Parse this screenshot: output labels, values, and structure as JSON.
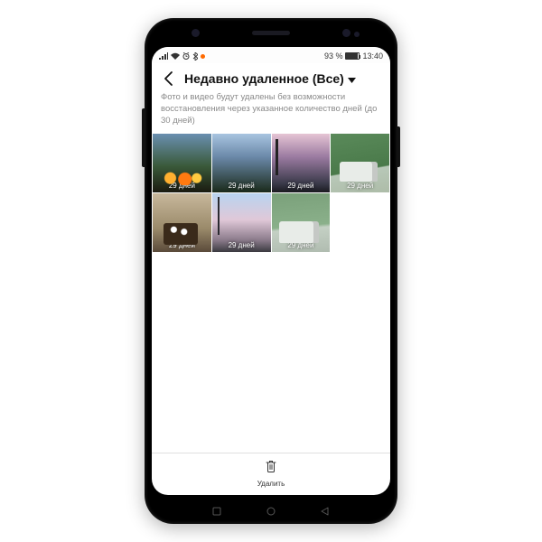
{
  "statusbar": {
    "battery_pct": "93 %",
    "time": "13:40"
  },
  "header": {
    "title": "Недавно удаленное (Все)"
  },
  "description": "Фото и видео будут удалены без возможности восстановления через указанное количество дней (до 30 дней)",
  "thumbnails": [
    {
      "days": "29 дней"
    },
    {
      "days": "29 дней"
    },
    {
      "days": "29 дней"
    },
    {
      "days": "29 дней"
    },
    {
      "days": "29 дней"
    },
    {
      "days": "29 дней"
    },
    {
      "days": "29 дней"
    }
  ],
  "bottombar": {
    "delete_label": "Удалить"
  }
}
